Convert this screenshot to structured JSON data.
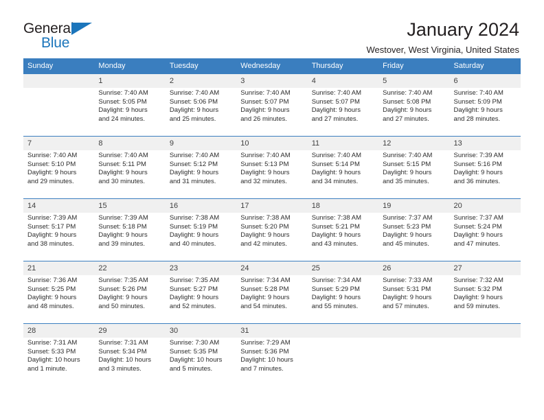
{
  "brand": {
    "name_part1": "General",
    "name_part2": "Blue",
    "accent_color": "#1b75bb",
    "triangle_icon": "triangle-icon"
  },
  "header": {
    "title": "January 2024",
    "subtitle": "Westover, West Virginia, United States"
  },
  "theme": {
    "header_row_bg": "#3a7ebf",
    "daynum_bg": "#f0f0f0",
    "text": "#2b2b2b"
  },
  "calendar": {
    "weekday_headers": [
      "Sunday",
      "Monday",
      "Tuesday",
      "Wednesday",
      "Thursday",
      "Friday",
      "Saturday"
    ],
    "weeks": [
      [
        {
          "day": "",
          "sunrise": "",
          "sunset": "",
          "daylight_line1": "",
          "daylight_line2": ""
        },
        {
          "day": "1",
          "sunrise": "Sunrise: 7:40 AM",
          "sunset": "Sunset: 5:05 PM",
          "daylight_line1": "Daylight: 9 hours",
          "daylight_line2": "and 24 minutes."
        },
        {
          "day": "2",
          "sunrise": "Sunrise: 7:40 AM",
          "sunset": "Sunset: 5:06 PM",
          "daylight_line1": "Daylight: 9 hours",
          "daylight_line2": "and 25 minutes."
        },
        {
          "day": "3",
          "sunrise": "Sunrise: 7:40 AM",
          "sunset": "Sunset: 5:07 PM",
          "daylight_line1": "Daylight: 9 hours",
          "daylight_line2": "and 26 minutes."
        },
        {
          "day": "4",
          "sunrise": "Sunrise: 7:40 AM",
          "sunset": "Sunset: 5:07 PM",
          "daylight_line1": "Daylight: 9 hours",
          "daylight_line2": "and 27 minutes."
        },
        {
          "day": "5",
          "sunrise": "Sunrise: 7:40 AM",
          "sunset": "Sunset: 5:08 PM",
          "daylight_line1": "Daylight: 9 hours",
          "daylight_line2": "and 27 minutes."
        },
        {
          "day": "6",
          "sunrise": "Sunrise: 7:40 AM",
          "sunset": "Sunset: 5:09 PM",
          "daylight_line1": "Daylight: 9 hours",
          "daylight_line2": "and 28 minutes."
        }
      ],
      [
        {
          "day": "7",
          "sunrise": "Sunrise: 7:40 AM",
          "sunset": "Sunset: 5:10 PM",
          "daylight_line1": "Daylight: 9 hours",
          "daylight_line2": "and 29 minutes."
        },
        {
          "day": "8",
          "sunrise": "Sunrise: 7:40 AM",
          "sunset": "Sunset: 5:11 PM",
          "daylight_line1": "Daylight: 9 hours",
          "daylight_line2": "and 30 minutes."
        },
        {
          "day": "9",
          "sunrise": "Sunrise: 7:40 AM",
          "sunset": "Sunset: 5:12 PM",
          "daylight_line1": "Daylight: 9 hours",
          "daylight_line2": "and 31 minutes."
        },
        {
          "day": "10",
          "sunrise": "Sunrise: 7:40 AM",
          "sunset": "Sunset: 5:13 PM",
          "daylight_line1": "Daylight: 9 hours",
          "daylight_line2": "and 32 minutes."
        },
        {
          "day": "11",
          "sunrise": "Sunrise: 7:40 AM",
          "sunset": "Sunset: 5:14 PM",
          "daylight_line1": "Daylight: 9 hours",
          "daylight_line2": "and 34 minutes."
        },
        {
          "day": "12",
          "sunrise": "Sunrise: 7:40 AM",
          "sunset": "Sunset: 5:15 PM",
          "daylight_line1": "Daylight: 9 hours",
          "daylight_line2": "and 35 minutes."
        },
        {
          "day": "13",
          "sunrise": "Sunrise: 7:39 AM",
          "sunset": "Sunset: 5:16 PM",
          "daylight_line1": "Daylight: 9 hours",
          "daylight_line2": "and 36 minutes."
        }
      ],
      [
        {
          "day": "14",
          "sunrise": "Sunrise: 7:39 AM",
          "sunset": "Sunset: 5:17 PM",
          "daylight_line1": "Daylight: 9 hours",
          "daylight_line2": "and 38 minutes."
        },
        {
          "day": "15",
          "sunrise": "Sunrise: 7:39 AM",
          "sunset": "Sunset: 5:18 PM",
          "daylight_line1": "Daylight: 9 hours",
          "daylight_line2": "and 39 minutes."
        },
        {
          "day": "16",
          "sunrise": "Sunrise: 7:38 AM",
          "sunset": "Sunset: 5:19 PM",
          "daylight_line1": "Daylight: 9 hours",
          "daylight_line2": "and 40 minutes."
        },
        {
          "day": "17",
          "sunrise": "Sunrise: 7:38 AM",
          "sunset": "Sunset: 5:20 PM",
          "daylight_line1": "Daylight: 9 hours",
          "daylight_line2": "and 42 minutes."
        },
        {
          "day": "18",
          "sunrise": "Sunrise: 7:38 AM",
          "sunset": "Sunset: 5:21 PM",
          "daylight_line1": "Daylight: 9 hours",
          "daylight_line2": "and 43 minutes."
        },
        {
          "day": "19",
          "sunrise": "Sunrise: 7:37 AM",
          "sunset": "Sunset: 5:23 PM",
          "daylight_line1": "Daylight: 9 hours",
          "daylight_line2": "and 45 minutes."
        },
        {
          "day": "20",
          "sunrise": "Sunrise: 7:37 AM",
          "sunset": "Sunset: 5:24 PM",
          "daylight_line1": "Daylight: 9 hours",
          "daylight_line2": "and 47 minutes."
        }
      ],
      [
        {
          "day": "21",
          "sunrise": "Sunrise: 7:36 AM",
          "sunset": "Sunset: 5:25 PM",
          "daylight_line1": "Daylight: 9 hours",
          "daylight_line2": "and 48 minutes."
        },
        {
          "day": "22",
          "sunrise": "Sunrise: 7:35 AM",
          "sunset": "Sunset: 5:26 PM",
          "daylight_line1": "Daylight: 9 hours",
          "daylight_line2": "and 50 minutes."
        },
        {
          "day": "23",
          "sunrise": "Sunrise: 7:35 AM",
          "sunset": "Sunset: 5:27 PM",
          "daylight_line1": "Daylight: 9 hours",
          "daylight_line2": "and 52 minutes."
        },
        {
          "day": "24",
          "sunrise": "Sunrise: 7:34 AM",
          "sunset": "Sunset: 5:28 PM",
          "daylight_line1": "Daylight: 9 hours",
          "daylight_line2": "and 54 minutes."
        },
        {
          "day": "25",
          "sunrise": "Sunrise: 7:34 AM",
          "sunset": "Sunset: 5:29 PM",
          "daylight_line1": "Daylight: 9 hours",
          "daylight_line2": "and 55 minutes."
        },
        {
          "day": "26",
          "sunrise": "Sunrise: 7:33 AM",
          "sunset": "Sunset: 5:31 PM",
          "daylight_line1": "Daylight: 9 hours",
          "daylight_line2": "and 57 minutes."
        },
        {
          "day": "27",
          "sunrise": "Sunrise: 7:32 AM",
          "sunset": "Sunset: 5:32 PM",
          "daylight_line1": "Daylight: 9 hours",
          "daylight_line2": "and 59 minutes."
        }
      ],
      [
        {
          "day": "28",
          "sunrise": "Sunrise: 7:31 AM",
          "sunset": "Sunset: 5:33 PM",
          "daylight_line1": "Daylight: 10 hours",
          "daylight_line2": "and 1 minute."
        },
        {
          "day": "29",
          "sunrise": "Sunrise: 7:31 AM",
          "sunset": "Sunset: 5:34 PM",
          "daylight_line1": "Daylight: 10 hours",
          "daylight_line2": "and 3 minutes."
        },
        {
          "day": "30",
          "sunrise": "Sunrise: 7:30 AM",
          "sunset": "Sunset: 5:35 PM",
          "daylight_line1": "Daylight: 10 hours",
          "daylight_line2": "and 5 minutes."
        },
        {
          "day": "31",
          "sunrise": "Sunrise: 7:29 AM",
          "sunset": "Sunset: 5:36 PM",
          "daylight_line1": "Daylight: 10 hours",
          "daylight_line2": "and 7 minutes."
        },
        {
          "day": "",
          "sunrise": "",
          "sunset": "",
          "daylight_line1": "",
          "daylight_line2": ""
        },
        {
          "day": "",
          "sunrise": "",
          "sunset": "",
          "daylight_line1": "",
          "daylight_line2": ""
        },
        {
          "day": "",
          "sunrise": "",
          "sunset": "",
          "daylight_line1": "",
          "daylight_line2": ""
        }
      ]
    ]
  }
}
